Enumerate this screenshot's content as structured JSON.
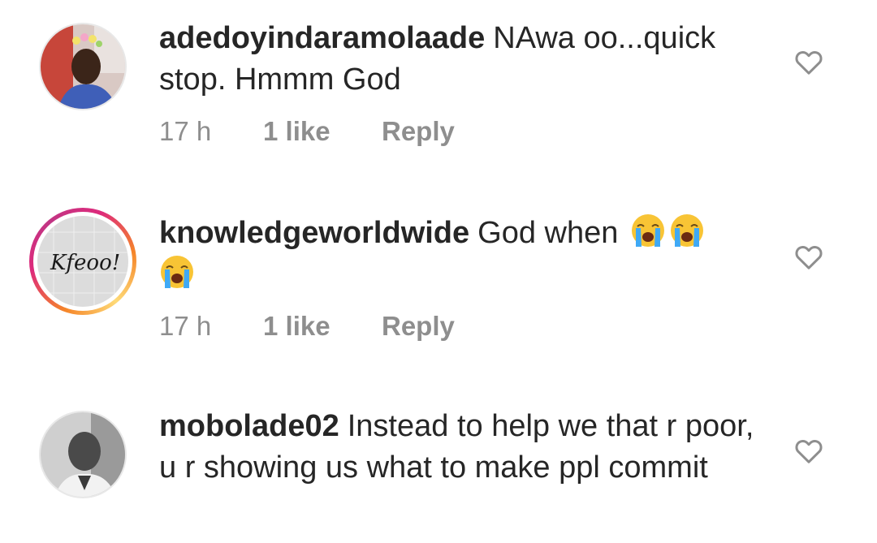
{
  "comments": [
    {
      "username": "adedoyindaramolaade",
      "text": "NAwa oo...quick stop. Hmmm God",
      "time": "17 h",
      "likes": "1 like",
      "reply": "Reply",
      "avatar_icon": "user-photo-avatar"
    },
    {
      "username": "knowledgeworldwide",
      "text": "God when",
      "emoji": "loudly-crying-face",
      "emoji_count": 3,
      "time": "17 h",
      "likes": "1 like",
      "reply": "Reply",
      "avatar_icon": "story-ring-avatar",
      "avatar_logo_text": "Kfeoo!"
    },
    {
      "username": "mobolade02",
      "text": "Instead to help we that r poor, u r showing us what to make ppl commit",
      "avatar_icon": "user-photo-avatar"
    }
  ],
  "colors": {
    "text": "#262626",
    "meta": "#8e8e8e",
    "story_ring_start": "#f58529",
    "story_ring_end": "#dd2a7b"
  },
  "icons": {
    "like": "heart-outline-icon"
  }
}
